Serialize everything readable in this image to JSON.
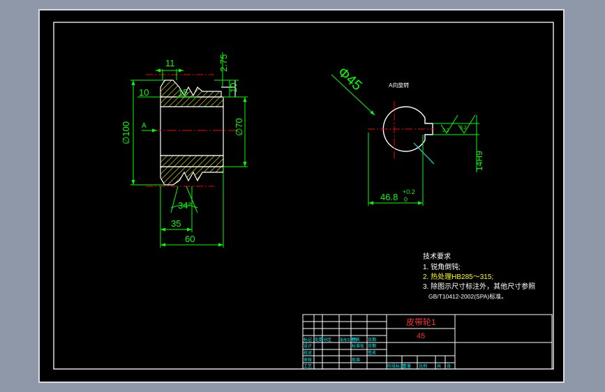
{
  "colors": {
    "background": "#000000",
    "outline": "#ffffff",
    "dimension": "#00ff00",
    "hatch": "#ffff00",
    "center": "#ff0000",
    "leader": "#00ffff",
    "text": "#ffffff",
    "title_red": "#ff3030",
    "table_text": "#00ffff"
  },
  "dims": {
    "d11": "11",
    "d275": "2.75",
    "d10a": "10",
    "d15": "15",
    "d10b": "10",
    "d100": "∅100",
    "d70": "∅70",
    "d34": "34°",
    "d35": "35",
    "d60": "60",
    "view_a": "A",
    "d45": "Φ45",
    "view_label": "A向旋转",
    "dkey": "46.8",
    "dkey_tol_up": "+0.2",
    "dkey_tol_dn": "0",
    "d14h9": "14H9",
    "rough1": "3.2",
    "rough2": "3.2"
  },
  "notes": {
    "title": "技术要求",
    "line1": "1. 锐角倒钝;",
    "line2": "2. 热处理HB285～315;",
    "line3": "3. 除图示尺寸标注外，其他尺寸参照",
    "line4": "GB/T10412-2002(SPA)标准。"
  },
  "title_block": {
    "part_name": "皮带轮1",
    "material": "45",
    "row_labels": [
      "标记",
      "设计",
      "校对",
      "审核",
      "工艺"
    ],
    "col_labels": [
      "处数",
      "分区",
      "更改文件号",
      "签名",
      "日期"
    ],
    "misc": [
      "标准化",
      "批准",
      "日期",
      "签名"
    ],
    "bottom_labels": [
      "阶段标记",
      "重量",
      "比例",
      "共",
      "张"
    ]
  }
}
